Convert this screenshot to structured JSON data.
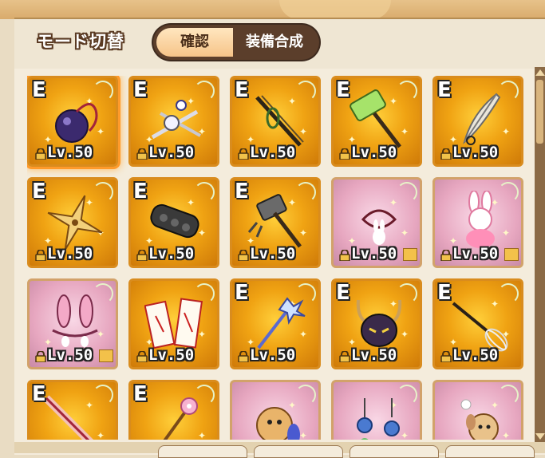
{
  "header": {
    "mode_label": "モード切替",
    "toggle": {
      "active_label": "確認",
      "inactive_label": "装備合成"
    }
  },
  "items": [
    {
      "grade": "E",
      "level": "Lv.50",
      "icon": "bomb-icon",
      "frame": "gold",
      "selected": true
    },
    {
      "grade": "E",
      "level": "Lv.50",
      "icon": "scissors-icon",
      "frame": "gold"
    },
    {
      "grade": "E",
      "level": "Lv.50",
      "icon": "needle-icon",
      "frame": "gold"
    },
    {
      "grade": "E",
      "level": "Lv.50",
      "icon": "hammer-icon",
      "frame": "gold"
    },
    {
      "grade": "E",
      "level": "Lv.50",
      "icon": "feather-icon",
      "frame": "gold"
    },
    {
      "grade": "E",
      "level": "Lv.50",
      "icon": "shuriken-icon",
      "frame": "gold"
    },
    {
      "grade": "E",
      "level": "Lv.50",
      "icon": "knuckles-icon",
      "frame": "gold"
    },
    {
      "grade": "E",
      "level": "Lv.50",
      "icon": "mace-icon",
      "frame": "gold"
    },
    {
      "grade": "",
      "level": "Lv.50",
      "icon": "bunny-ribbon-icon",
      "frame": "pink"
    },
    {
      "grade": "",
      "level": "Lv.50",
      "icon": "bunny-plush-icon",
      "frame": "pink"
    },
    {
      "grade": "",
      "level": "Lv.50",
      "icon": "bunny-ears-icon",
      "frame": "pink"
    },
    {
      "grade": "",
      "level": "Lv.50",
      "icon": "talisman-icon",
      "frame": "gold"
    },
    {
      "grade": "E",
      "level": "Lv.50",
      "icon": "ice-staff-icon",
      "frame": "gold"
    },
    {
      "grade": "E",
      "level": "Lv.50",
      "icon": "demon-mask-icon",
      "frame": "gold"
    },
    {
      "grade": "E",
      "level": "Lv.50",
      "icon": "whisk-icon",
      "frame": "gold"
    },
    {
      "grade": "E",
      "level": "",
      "icon": "sword-icon",
      "frame": "gold"
    },
    {
      "grade": "E",
      "level": "",
      "icon": "flower-wand-icon",
      "frame": "gold"
    },
    {
      "grade": "",
      "level": "",
      "icon": "dog-plush-icon",
      "frame": "pink"
    },
    {
      "grade": "",
      "level": "",
      "icon": "earrings-icon",
      "frame": "pink"
    },
    {
      "grade": "",
      "level": "",
      "icon": "dog-pin-icon",
      "frame": "pink"
    }
  ],
  "colors": {
    "gold": "#f0a313",
    "pink": "#e7a7c0",
    "selected_glow": "#ff9a2a"
  }
}
